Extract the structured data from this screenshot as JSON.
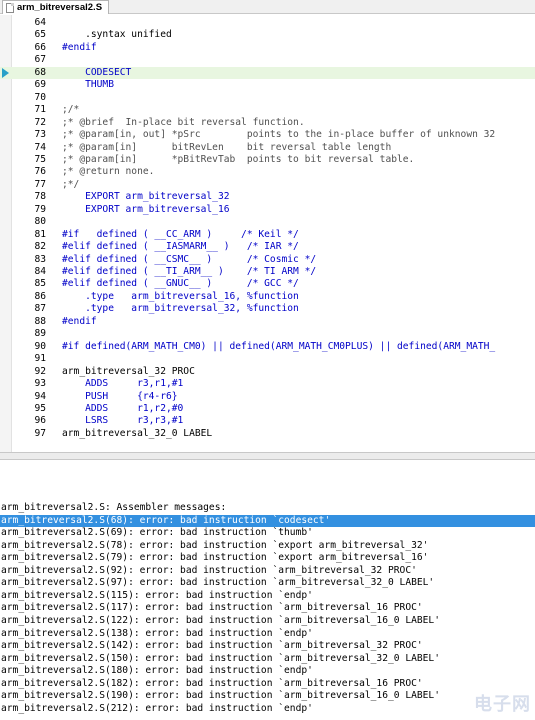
{
  "tab": {
    "label": "arm_bitreversal2.S"
  },
  "editor": {
    "lines": [
      {
        "n": "64",
        "code": ""
      },
      {
        "n": "65",
        "code": "    .syntax unified"
      },
      {
        "n": "66",
        "code": "#endif"
      },
      {
        "n": "67",
        "code": ""
      },
      {
        "n": "68",
        "code": "    CODESECT"
      },
      {
        "n": "69",
        "code": "    THUMB"
      },
      {
        "n": "70",
        "code": ""
      },
      {
        "n": "71",
        "code": ";/*"
      },
      {
        "n": "72",
        "code": ";* @brief  In-place bit reversal function."
      },
      {
        "n": "73",
        "code": ";* @param[in, out] *pSrc        points to the in-place buffer of unknown 32"
      },
      {
        "n": "74",
        "code": ";* @param[in]      bitRevLen    bit reversal table length"
      },
      {
        "n": "75",
        "code": ";* @param[in]      *pBitRevTab  points to bit reversal table."
      },
      {
        "n": "76",
        "code": ";* @return none."
      },
      {
        "n": "77",
        "code": ";*/"
      },
      {
        "n": "78",
        "code": "    EXPORT arm_bitreversal_32"
      },
      {
        "n": "79",
        "code": "    EXPORT arm_bitreversal_16"
      },
      {
        "n": "80",
        "code": ""
      },
      {
        "n": "81",
        "code": "#if   defined ( __CC_ARM )     /* Keil */"
      },
      {
        "n": "82",
        "code": "#elif defined ( __IASMARM__ )   /* IAR */"
      },
      {
        "n": "83",
        "code": "#elif defined ( __CSMC__ )      /* Cosmic */"
      },
      {
        "n": "84",
        "code": "#elif defined ( __TI_ARM__ )    /* TI ARM */"
      },
      {
        "n": "85",
        "code": "#elif defined ( __GNUC__ )      /* GCC */"
      },
      {
        "n": "86",
        "code": "    .type   arm_bitreversal_16, %function"
      },
      {
        "n": "87",
        "code": "    .type   arm_bitreversal_32, %function"
      },
      {
        "n": "88",
        "code": "#endif"
      },
      {
        "n": "89",
        "code": ""
      },
      {
        "n": "90",
        "code": "#if defined(ARM_MATH_CM0) || defined(ARM_MATH_CM0PLUS) || defined(ARM_MATH_"
      },
      {
        "n": "91",
        "code": ""
      },
      {
        "n": "92",
        "code": "arm_bitreversal_32 PROC"
      },
      {
        "n": "93",
        "code": "    ADDS     r3,r1,#1"
      },
      {
        "n": "94",
        "code": "    PUSH     {r4-r6}"
      },
      {
        "n": "95",
        "code": "    ADDS     r1,r2,#0"
      },
      {
        "n": "96",
        "code": "    LSRS     r3,r3,#1"
      },
      {
        "n": "97",
        "code": "arm_bitreversal_32_0 LABEL"
      }
    ],
    "current_line": "68"
  },
  "output": {
    "lines": [
      "arm_bitreversal2.S: Assembler messages:",
      "arm_bitreversal2.S(68): error: bad instruction `codesect'",
      "arm_bitreversal2.S(69): error: bad instruction `thumb'",
      "arm_bitreversal2.S(78): error: bad instruction `export arm_bitreversal_32'",
      "arm_bitreversal2.S(79): error: bad instruction `export arm_bitreversal_16'",
      "arm_bitreversal2.S(92): error: bad instruction `arm_bitreversal_32 PROC'",
      "arm_bitreversal2.S(97): error: bad instruction `arm_bitreversal_32_0 LABEL'",
      "arm_bitreversal2.S(115): error: bad instruction `endp'",
      "arm_bitreversal2.S(117): error: bad instruction `arm_bitreversal_16 PROC'",
      "arm_bitreversal2.S(122): error: bad instruction `arm_bitreversal_16_0 LABEL'",
      "arm_bitreversal2.S(138): error: bad instruction `endp'",
      "arm_bitreversal2.S(142): error: bad instruction `arm_bitreversal_32 PROC'",
      "arm_bitreversal2.S(150): error: bad instruction `arm_bitreversal_32_0 LABEL'",
      "arm_bitreversal2.S(180): error: bad instruction `endp'",
      "arm_bitreversal2.S(182): error: bad instruction `arm_bitreversal_16 PROC'",
      "arm_bitreversal2.S(190): error: bad instruction `arm_bitreversal_16_0 LABEL'",
      "arm_bitreversal2.S(212): error: bad instruction `endp'"
    ],
    "selected_index": 1
  },
  "watermark": "电子网",
  "colors": {
    "selection": "#3390e0",
    "current_line": "#e8f6e0",
    "keyword": "#0000c8",
    "marker": "#28a0c8"
  }
}
